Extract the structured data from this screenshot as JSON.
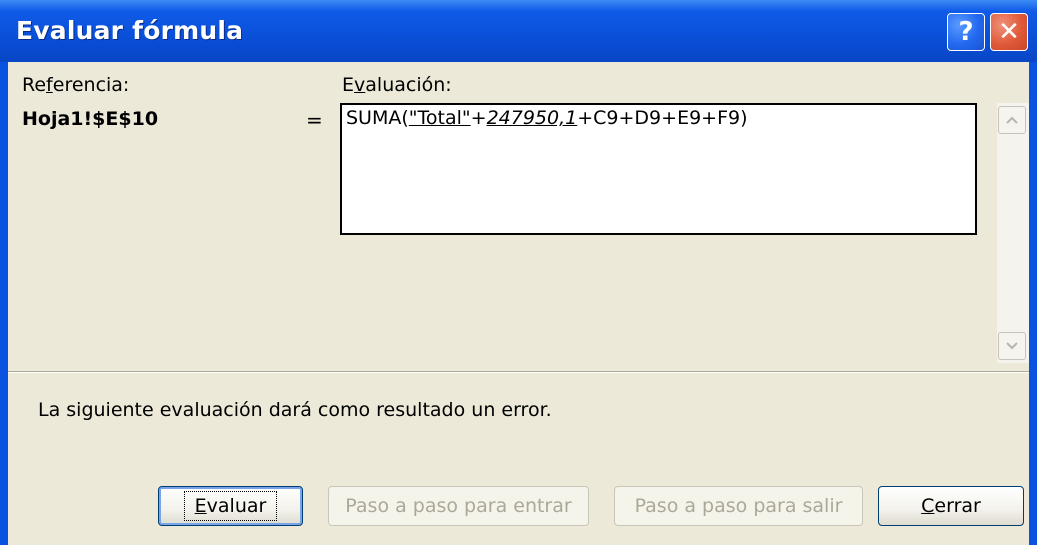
{
  "window": {
    "title": "Evaluar fórmula",
    "help_glyph": "?",
    "close_glyph": "✕",
    "titlebar_color": "#0A53E0",
    "client_bg": "#ECE9D8"
  },
  "reference": {
    "label_pre": "Re",
    "label_accel": "f",
    "label_post": "erencia:",
    "value": "Hoja1!$E$10"
  },
  "evaluation": {
    "label_pre": "E",
    "label_accel": "v",
    "label_post": "aluación:",
    "equals": "=",
    "formula": {
      "prefix": "SUMA(",
      "underlined_ref": "\"Total\"",
      "operator": "+",
      "evaluated_value": "247950,1",
      "suffix": "+C9+D9+E9+F9)"
    }
  },
  "scrollbar": {
    "up_icon": "chevron-up",
    "down_icon": "chevron-down"
  },
  "message": "La siguiente evaluación dará como resultado un error.",
  "buttons": {
    "evaluate": {
      "accel": "E",
      "rest": "valuar",
      "enabled": true,
      "default": true
    },
    "step_in": {
      "label": "Paso a paso para entrar",
      "enabled": false
    },
    "step_out": {
      "label": "Paso a paso para salir",
      "enabled": false
    },
    "close": {
      "accel": "C",
      "rest": "errar",
      "enabled": true
    }
  }
}
